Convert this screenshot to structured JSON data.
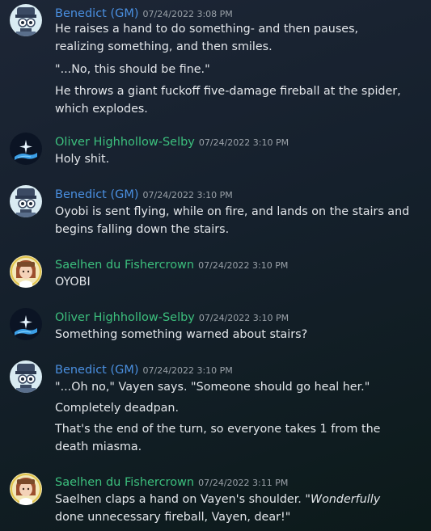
{
  "messages": [
    {
      "username": "Benedict (GM)",
      "timestamp": "07/24/2022 3:08 PM",
      "lines": [
        "He raises a hand to do something- and then pauses, realizing something, and then smiles.",
        "\"...No, this should be fine.\"",
        "He throws a giant fuckoff five-damage fireball at the spider, which explodes."
      ]
    },
    {
      "username": "Oliver Highhollow-Selby",
      "timestamp": "07/24/2022 3:10 PM",
      "lines": [
        "Holy shit."
      ]
    },
    {
      "username": "Benedict (GM)",
      "timestamp": "07/24/2022 3:10 PM",
      "lines": [
        "Oyobi is sent flying, while on fire, and lands on the stairs and begins falling down the stairs."
      ]
    },
    {
      "username": "Saelhen du Fishercrown",
      "timestamp": "07/24/2022 3:10 PM",
      "lines": [
        "OYOBI"
      ]
    },
    {
      "username": "Oliver Highhollow-Selby",
      "timestamp": "07/24/2022 3:10 PM",
      "lines": [
        "Something something warned about stairs?"
      ]
    },
    {
      "username": "Benedict (GM)",
      "timestamp": "07/24/2022 3:10 PM",
      "lines": [
        "\"...Oh no,\" Vayen says. \"Someone should go heal her.\"",
        "Completely deadpan.",
        "That's the end of the turn, so everyone takes 1 from the death miasma."
      ]
    },
    {
      "username": "Saelhen du Fishercrown",
      "timestamp": "07/24/2022 3:11 PM",
      "lines": [
        {
          "before": "Saelhen claps a hand on Vayen's shoulder. \"",
          "em": "Wonderfully",
          "after": " done unnecessary fireball, Vayen, dear!\""
        }
      ]
    }
  ],
  "colors": {
    "gm_name": "#4a8fe0",
    "player_name": "#3cbf7d",
    "text": "#e3e6ea",
    "timestamp": "#9aa1a8"
  },
  "icons": {
    "gm_avatar": "skull-avatar-icon",
    "oliver_avatar": "star-hand-avatar-icon",
    "saelhen_avatar": "portrait-avatar-icon"
  }
}
